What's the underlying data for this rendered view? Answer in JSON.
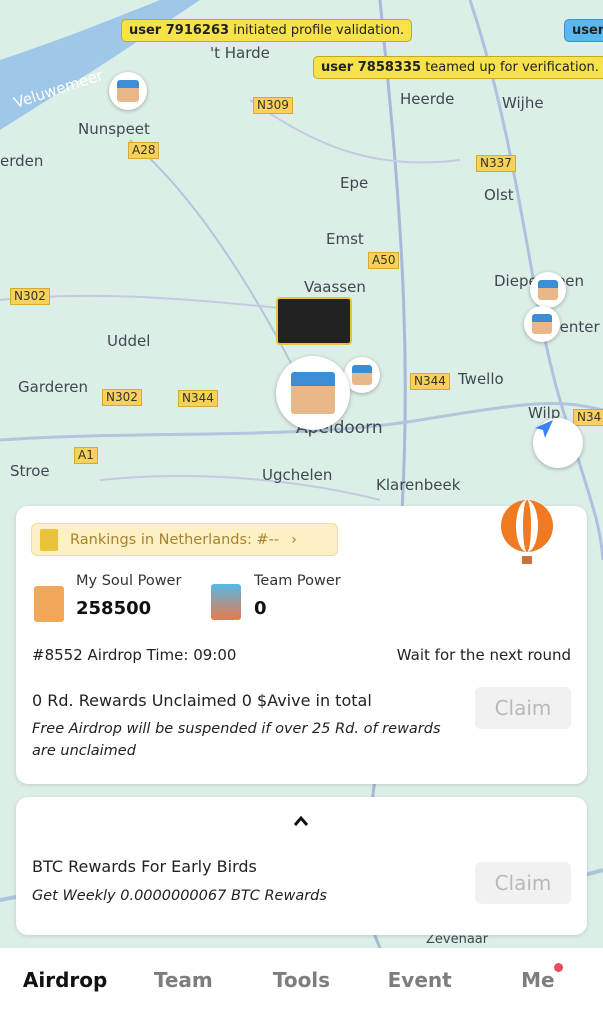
{
  "toasts": [
    {
      "user": "user 7916263",
      "text": " initiated profile validation."
    },
    {
      "user": "user 7858335",
      "text": " teamed up for verification."
    },
    {
      "user": "user",
      "text": ""
    }
  ],
  "map": {
    "places": [
      "Veluwemeer",
      "'t Harde",
      "Nunspeet",
      "Heerde",
      "Wijhe",
      "erden",
      "Epe",
      "Olst",
      "Emst",
      "Vaassen",
      "Diepenveen",
      "Deventer",
      "Uddel",
      "Garderen",
      "Twello",
      "Apeldoorn",
      "Wilp",
      "Stroe",
      "Ugchelen",
      "Klarenbeek",
      "Zevenaar"
    ],
    "roads": [
      "N309",
      "A28",
      "N337",
      "A50",
      "N302",
      "N302",
      "N344",
      "N344",
      "A1",
      "N34"
    ]
  },
  "card1": {
    "ranking": "Rankings in Netherlands: #--",
    "soul_label": "My Soul Power",
    "soul_value": "258500",
    "team_label": "Team Power",
    "team_value": "0",
    "airdrop_time": "#8552 Airdrop Time: 09:00",
    "status": "Wait for the next round",
    "unclaimed": "0 Rd. Rewards Unclaimed 0 $Avive in total",
    "warning": "Free Airdrop will be suspended if over 25 Rd. of rewards are unclaimed",
    "claim": "Claim"
  },
  "card2": {
    "title": "BTC Rewards For Early Birds",
    "subtitle": "Get Weekly 0.0000000067 BTC Rewards",
    "claim": "Claim"
  },
  "tabs": [
    "Airdrop",
    "Team",
    "Tools",
    "Event",
    "Me"
  ],
  "colors": {
    "accent": "#f7e24a",
    "badge": "#ec4a5d",
    "map": "#dcefe6"
  }
}
